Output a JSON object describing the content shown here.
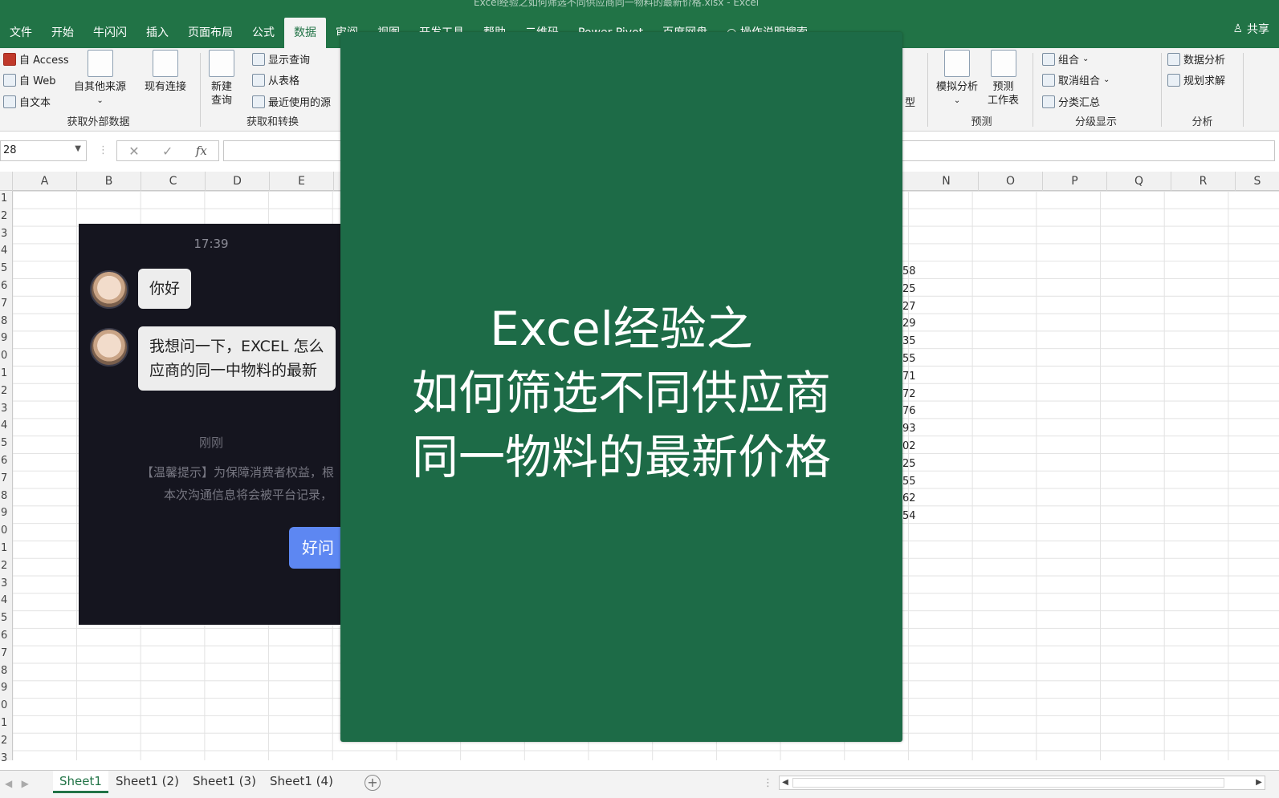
{
  "window": {
    "title": "Excel经验之如何筛选不同供应商同一物料的最新价格.xlsx - Excel"
  },
  "menu": {
    "tabs": [
      "文件",
      "开始",
      "牛闪闪",
      "插入",
      "页面布局",
      "公式",
      "数据",
      "审阅",
      "视图",
      "开发工具",
      "帮助",
      "二维码",
      "Power Pivot",
      "百度网盘",
      "操作说明搜索"
    ],
    "active_tab": "数据",
    "share": "共享"
  },
  "ribbon": {
    "external": {
      "access": "自 Access",
      "web": "自 Web",
      "text": "自文本",
      "other": "自其他来源",
      "existing": "现有连接",
      "label": "获取外部数据"
    },
    "transform": {
      "new_query": "新建\n查询",
      "new_query_1": "新建",
      "new_query_2": "查询",
      "show_query": "显示查询",
      "from_table": "从表格",
      "recent": "最近使用的源",
      "label": "获取和转换"
    },
    "model_partial": "型",
    "forecast": {
      "whatif": "模拟分析",
      "sheet_1": "预测",
      "sheet_2": "工作表",
      "label": "预测"
    },
    "outline": {
      "group": "组合",
      "ungroup": "取消组合",
      "subtotal": "分类汇总",
      "label": "分级显示"
    },
    "analysis": {
      "data_analysis": "数据分析",
      "solver": "规划求解",
      "label": "分析"
    }
  },
  "formula_bar": {
    "name_box": "28",
    "fx": "fx"
  },
  "columns": [
    "A",
    "B",
    "C",
    "D",
    "E",
    "N",
    "O",
    "P",
    "Q",
    "R",
    "S"
  ],
  "rows": [
    "1",
    "2",
    "3",
    "4",
    "5",
    "6",
    "7",
    "8",
    "9",
    "0",
    "1",
    "2",
    "3",
    "4",
    "5",
    "6",
    "7",
    "8",
    "9",
    "0",
    "1",
    "2",
    "3",
    "4",
    "5",
    "6",
    "7",
    "8",
    "9",
    "0",
    "1",
    "2",
    "3"
  ],
  "cell_values": [
    "58",
    "25",
    "27",
    "29",
    "35",
    "55",
    "71",
    "72",
    "76",
    "93",
    "02",
    "25",
    "55",
    "62",
    "54"
  ],
  "chat": {
    "time": "17:39",
    "msg1": "你好",
    "msg2_line1": "我想问一下，EXCEL 怎么",
    "msg2_line2": "应商的同一中物料的最新",
    "just_now": "刚刚",
    "tip_line1": "【温馨提示】为保障消费者权益，根",
    "tip_line2": "本次沟通信息将会被平台记录，",
    "button": "好问"
  },
  "cover": {
    "line1": "Excel经验之",
    "line2": "如何筛选不同供应商",
    "line3": "同一物料的最新价格"
  },
  "sheets": [
    "Sheet1",
    "Sheet1 (2)",
    "Sheet1 (3)",
    "Sheet1 (4)"
  ],
  "active_sheet": "Sheet1",
  "colors": {
    "excel_green": "#217346",
    "cover_green": "#1d6b47",
    "chat_bg": "#15151f",
    "chat_button": "#5d87f2"
  }
}
